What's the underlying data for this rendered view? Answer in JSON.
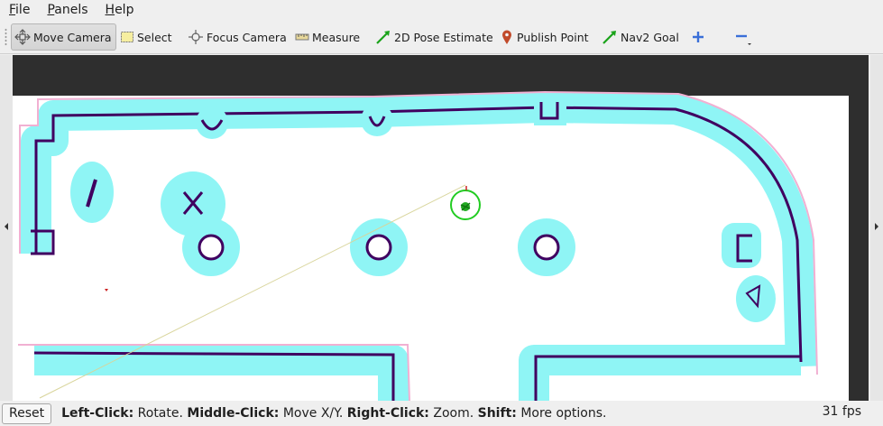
{
  "menubar": {
    "items": [
      {
        "label": "File",
        "accel": "F",
        "rest": "ile"
      },
      {
        "label": "Panels",
        "accel": "P",
        "rest": "anels"
      },
      {
        "label": "Help",
        "accel": "H",
        "rest": "elp"
      }
    ]
  },
  "toolbar": {
    "tools": [
      {
        "label": "Move Camera",
        "icon": "move-camera-icon",
        "active": true
      },
      {
        "label": "Select",
        "icon": "select-icon"
      },
      {
        "label": "Focus Camera",
        "icon": "focus-camera-icon"
      },
      {
        "label": "Measure",
        "icon": "ruler-icon"
      },
      {
        "label": "2D Pose Estimate",
        "icon": "green-arrow-icon"
      },
      {
        "label": "Publish Point",
        "icon": "map-pin-icon"
      },
      {
        "label": "Nav2 Goal",
        "icon": "green-arrow-icon"
      }
    ],
    "add_icon": "plus-icon",
    "remove_icon": "minus-icon"
  },
  "statusbar": {
    "reset_label": "Reset",
    "hints": [
      {
        "key": "Left-Click:",
        "text": "Rotate."
      },
      {
        "key": "Middle-Click:",
        "text": "Move X/Y."
      },
      {
        "key": "Right-Click:",
        "text": "Zoom."
      },
      {
        "key": "Shift:",
        "text": "More options."
      }
    ],
    "fps": "31 fps"
  },
  "colors": {
    "map_free": "#ffffff",
    "costmap_inflation": "#8ff5f5",
    "costmap_lethal": "#400060",
    "robot_circle": "#22cc22",
    "background": "#2e2e2e"
  }
}
